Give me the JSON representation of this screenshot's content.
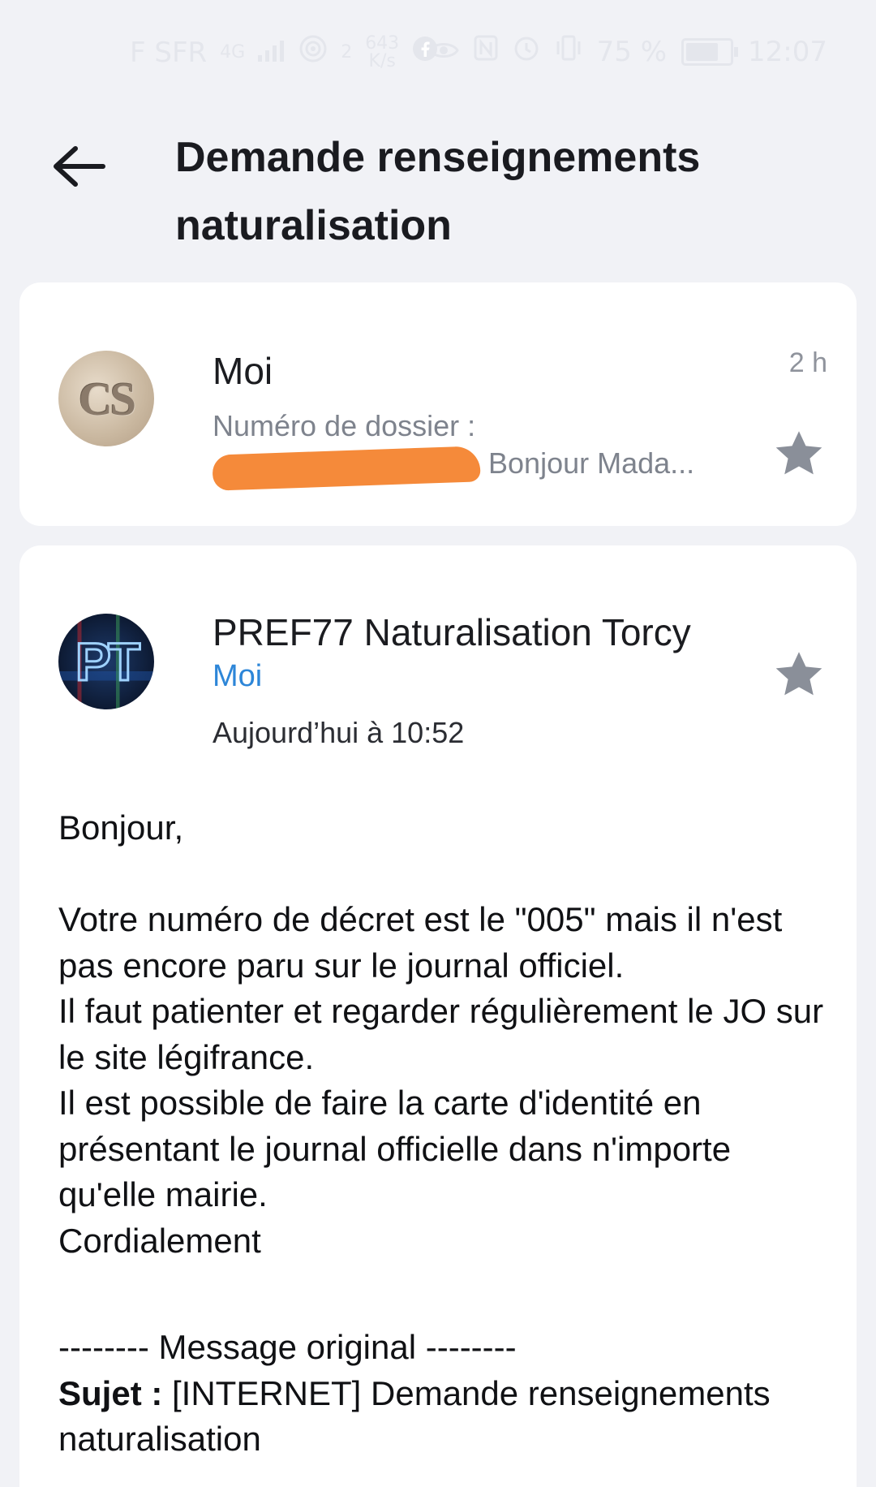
{
  "status_bar": {
    "carrier": "F SFR",
    "network": "4G",
    "signal_sub": "2",
    "speed_value": "643",
    "speed_unit": "K/s",
    "battery_percent": "75 %",
    "battery_level": 0.75,
    "time": "12:07"
  },
  "header": {
    "title": "Demande renseignements naturalisation"
  },
  "thread": [
    {
      "avatar_text": "CS",
      "sender": "Moi",
      "time": "2 h",
      "preview_line1": "Numéro de dossier :",
      "preview_line2": "Bonjour Mada..."
    },
    {
      "avatar_text": "PT",
      "sender": "PREF77 Naturalisation Torcy",
      "to": "Moi",
      "date": "Aujourd’hui à 10:52",
      "body": "Bonjour,\n\nVotre numéro de décret est le \"005\" mais il n'est pas encore paru sur le journal officiel.\nIl faut patienter et regarder régulièrement le JO sur le site légifrance.\nIl est possible de faire la carte d'identité en présentant le journal officielle dans n'importe qu'elle mairie.\nCordialement",
      "original_separator": "-------- Message original --------",
      "subject_label": "Sujet :",
      "subject_value": "[INTERNET] Demande renseignements naturalisation"
    }
  ],
  "colors": {
    "accent_blue": "#2d86d8",
    "star_gray": "#8a8f99",
    "redaction_orange": "#f58a3a"
  }
}
